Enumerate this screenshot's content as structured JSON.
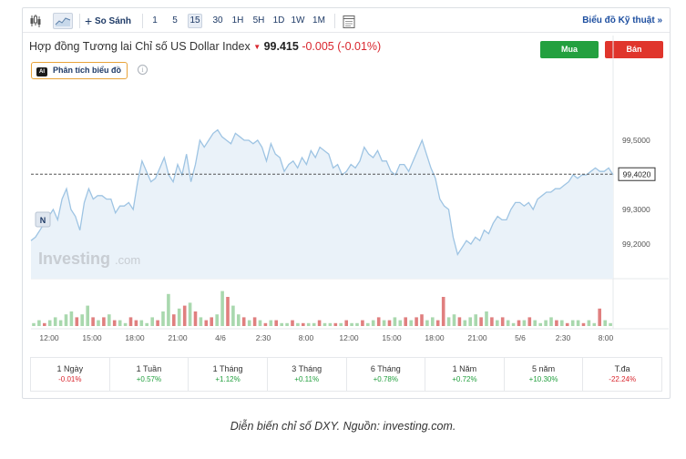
{
  "toolbar": {
    "compare_label": "So Sánh",
    "intervals": [
      "1",
      "5",
      "15",
      "30",
      "1H",
      "5H",
      "1D",
      "1W",
      "1M"
    ],
    "active_interval": "15",
    "tech_chart_link": "Biểu đồ Kỹ thuật"
  },
  "header": {
    "instrument": "Hợp đồng Tương lai Chỉ số US Dollar Index",
    "price": "99.415",
    "change": "-0.005",
    "change_pct": "(-0.01%)",
    "buy_label": "Mua",
    "sell_label": "Bán",
    "analysis_badge": "AI",
    "analysis_label": "Phân tích biểu đồ",
    "info_icon": "i"
  },
  "chart": {
    "watermark_main": "Investing",
    "watermark_suffix": ".com",
    "news_marker": "N",
    "current_price_label": "99,4020",
    "colors": {
      "line": "#9ec4e3",
      "area": "#eaf2f9",
      "up_bar": "#a9d8ae",
      "down_bar": "#e07f7f",
      "dash": "#555555"
    }
  },
  "chart_data": {
    "type": "area",
    "x_tick_labels": [
      "12:00",
      "15:00",
      "18:00",
      "21:00",
      "4/6",
      "2:30",
      "8:00",
      "12:00",
      "15:00",
      "18:00",
      "21:00",
      "5/6",
      "2:30",
      "8:00"
    ],
    "y_tick_labels": [
      "99,5000",
      "99,3000",
      "99,2000"
    ],
    "ylim": [
      99.1,
      99.65
    ],
    "current_value": 99.402,
    "price_series": [
      99.21,
      99.22,
      99.24,
      99.26,
      99.28,
      99.3,
      99.27,
      99.33,
      99.36,
      99.3,
      99.28,
      99.24,
      99.32,
      99.36,
      99.33,
      99.34,
      99.34,
      99.33,
      99.33,
      99.29,
      99.31,
      99.31,
      99.32,
      99.3,
      99.38,
      99.44,
      99.41,
      99.38,
      99.39,
      99.42,
      99.45,
      99.4,
      99.38,
      99.43,
      99.4,
      99.46,
      99.38,
      99.43,
      99.5,
      99.48,
      99.5,
      99.52,
      99.53,
      99.51,
      99.5,
      99.49,
      99.52,
      99.51,
      99.5,
      99.5,
      99.49,
      99.5,
      99.48,
      99.44,
      99.49,
      99.46,
      99.45,
      99.41,
      99.43,
      99.44,
      99.42,
      99.45,
      99.43,
      99.47,
      99.45,
      99.48,
      99.47,
      99.46,
      99.42,
      99.43,
      99.4,
      99.41,
      99.43,
      99.42,
      99.44,
      99.48,
      99.46,
      99.45,
      99.47,
      99.44,
      99.44,
      99.41,
      99.4,
      99.43,
      99.43,
      99.41,
      99.44,
      99.47,
      99.5,
      99.46,
      99.42,
      99.39,
      99.33,
      99.31,
      99.3,
      99.22,
      99.17,
      99.19,
      99.21,
      99.2,
      99.22,
      99.21,
      99.24,
      99.23,
      99.26,
      99.28,
      99.27,
      99.27,
      99.3,
      99.32,
      99.32,
      99.31,
      99.32,
      99.3,
      99.33,
      99.34,
      99.35,
      99.35,
      99.36,
      99.36,
      99.37,
      99.38,
      99.4,
      99.39,
      99.4,
      99.4,
      99.41,
      99.42,
      99.41,
      99.41,
      99.42,
      99.4
    ],
    "volume_series": [
      {
        "v": 1,
        "up": true
      },
      {
        "v": 2,
        "up": true
      },
      {
        "v": 1,
        "up": false
      },
      {
        "v": 2,
        "up": true
      },
      {
        "v": 3,
        "up": true
      },
      {
        "v": 2,
        "up": true
      },
      {
        "v": 4,
        "up": true
      },
      {
        "v": 5,
        "up": true
      },
      {
        "v": 3,
        "up": false
      },
      {
        "v": 4,
        "up": true
      },
      {
        "v": 7,
        "up": true
      },
      {
        "v": 3,
        "up": false
      },
      {
        "v": 2,
        "up": true
      },
      {
        "v": 3,
        "up": false
      },
      {
        "v": 4,
        "up": true
      },
      {
        "v": 2,
        "up": false
      },
      {
        "v": 2,
        "up": true
      },
      {
        "v": 1,
        "up": true
      },
      {
        "v": 3,
        "up": false
      },
      {
        "v": 2,
        "up": false
      },
      {
        "v": 2,
        "up": true
      },
      {
        "v": 1,
        "up": true
      },
      {
        "v": 3,
        "up": true
      },
      {
        "v": 2,
        "up": false
      },
      {
        "v": 5,
        "up": true
      },
      {
        "v": 11,
        "up": true
      },
      {
        "v": 4,
        "up": false
      },
      {
        "v": 6,
        "up": true
      },
      {
        "v": 7,
        "up": false
      },
      {
        "v": 8,
        "up": true
      },
      {
        "v": 5,
        "up": false
      },
      {
        "v": 3,
        "up": true
      },
      {
        "v": 2,
        "up": false
      },
      {
        "v": 3,
        "up": false
      },
      {
        "v": 4,
        "up": true
      },
      {
        "v": 12,
        "up": true
      },
      {
        "v": 10,
        "up": false
      },
      {
        "v": 7,
        "up": true
      },
      {
        "v": 4,
        "up": true
      },
      {
        "v": 3,
        "up": false
      },
      {
        "v": 2,
        "up": true
      },
      {
        "v": 3,
        "up": false
      },
      {
        "v": 2,
        "up": true
      },
      {
        "v": 1,
        "up": false
      },
      {
        "v": 2,
        "up": true
      },
      {
        "v": 2,
        "up": false
      },
      {
        "v": 1,
        "up": true
      },
      {
        "v": 1,
        "up": true
      },
      {
        "v": 2,
        "up": false
      },
      {
        "v": 1,
        "up": true
      },
      {
        "v": 1,
        "up": false
      },
      {
        "v": 1,
        "up": true
      },
      {
        "v": 1,
        "up": true
      },
      {
        "v": 2,
        "up": false
      },
      {
        "v": 1,
        "up": true
      },
      {
        "v": 1,
        "up": true
      },
      {
        "v": 1,
        "up": false
      },
      {
        "v": 1,
        "up": true
      },
      {
        "v": 2,
        "up": false
      },
      {
        "v": 1,
        "up": true
      },
      {
        "v": 1,
        "up": true
      },
      {
        "v": 2,
        "up": false
      },
      {
        "v": 1,
        "up": true
      },
      {
        "v": 2,
        "up": true
      },
      {
        "v": 3,
        "up": false
      },
      {
        "v": 2,
        "up": true
      },
      {
        "v": 2,
        "up": false
      },
      {
        "v": 3,
        "up": true
      },
      {
        "v": 2,
        "up": true
      },
      {
        "v": 3,
        "up": false
      },
      {
        "v": 2,
        "up": true
      },
      {
        "v": 3,
        "up": false
      },
      {
        "v": 4,
        "up": false
      },
      {
        "v": 2,
        "up": true
      },
      {
        "v": 3,
        "up": true
      },
      {
        "v": 2,
        "up": false
      },
      {
        "v": 10,
        "up": false
      },
      {
        "v": 3,
        "up": true
      },
      {
        "v": 4,
        "up": true
      },
      {
        "v": 3,
        "up": false
      },
      {
        "v": 2,
        "up": true
      },
      {
        "v": 3,
        "up": true
      },
      {
        "v": 4,
        "up": true
      },
      {
        "v": 3,
        "up": false
      },
      {
        "v": 5,
        "up": true
      },
      {
        "v": 3,
        "up": false
      },
      {
        "v": 2,
        "up": true
      },
      {
        "v": 3,
        "up": false
      },
      {
        "v": 2,
        "up": true
      },
      {
        "v": 1,
        "up": true
      },
      {
        "v": 2,
        "up": false
      },
      {
        "v": 2,
        "up": true
      },
      {
        "v": 3,
        "up": false
      },
      {
        "v": 2,
        "up": true
      },
      {
        "v": 1,
        "up": true
      },
      {
        "v": 2,
        "up": true
      },
      {
        "v": 3,
        "up": true
      },
      {
        "v": 2,
        "up": false
      },
      {
        "v": 2,
        "up": true
      },
      {
        "v": 1,
        "up": false
      },
      {
        "v": 2,
        "up": true
      },
      {
        "v": 2,
        "up": true
      },
      {
        "v": 1,
        "up": false
      },
      {
        "v": 2,
        "up": true
      },
      {
        "v": 1,
        "up": true
      },
      {
        "v": 6,
        "up": false
      },
      {
        "v": 2,
        "up": true
      },
      {
        "v": 1,
        "up": true
      }
    ]
  },
  "periods": [
    {
      "label": "1 Ngày",
      "value": "-0.01%",
      "positive": false
    },
    {
      "label": "1 Tuần",
      "value": "+0.57%",
      "positive": true
    },
    {
      "label": "1 Tháng",
      "value": "+1.12%",
      "positive": true
    },
    {
      "label": "3 Tháng",
      "value": "+0.11%",
      "positive": true
    },
    {
      "label": "6 Tháng",
      "value": "+0.78%",
      "positive": true
    },
    {
      "label": "1 Năm",
      "value": "+0.72%",
      "positive": true
    },
    {
      "label": "5 năm",
      "value": "+10.30%",
      "positive": true
    },
    {
      "label": "T.đa",
      "value": "-22.24%",
      "positive": false
    }
  ],
  "caption": "Diễn biến chỉ số DXY. Nguồn: investing.com."
}
